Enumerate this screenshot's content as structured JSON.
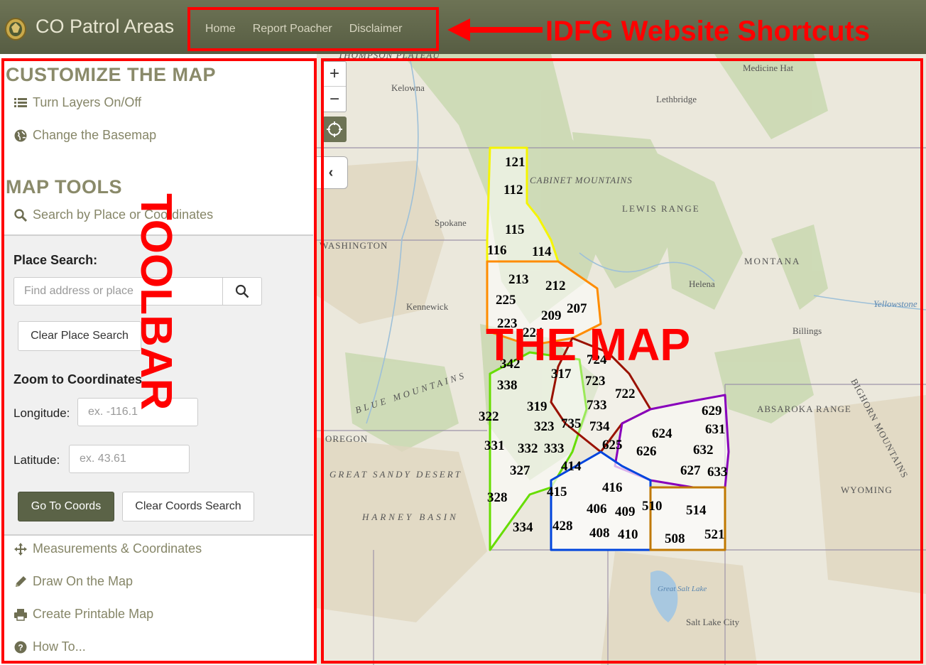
{
  "header": {
    "title": "CO Patrol Areas",
    "nav": [
      "Home",
      "Report Poacher",
      "Disclaimer"
    ]
  },
  "sidebar": {
    "customize_heading": "CUSTOMIZE THE MAP",
    "layers_label": "Turn Layers On/Off",
    "basemap_label": "Change the Basemap",
    "tools_heading": "MAP TOOLS",
    "search_label": "Search by Place or Coordinates",
    "place_search_label": "Place Search:",
    "address_placeholder": "Find address or place",
    "clear_place_label": "Clear Place Search",
    "zoom_coords_label": "Zoom to Coordinates",
    "longitude_label": "Longitude:",
    "longitude_placeholder": "ex. -116.1",
    "latitude_label": "Latitude:",
    "latitude_placeholder": "ex. 43.61",
    "go_coords_label": "Go To Coords",
    "clear_coords_label": "Clear Coords Search",
    "measure_label": "Measurements & Coordinates",
    "draw_label": "Draw On the Map",
    "print_label": "Create Printable Map",
    "howto_label": "How To..."
  },
  "map": {
    "place_labels": [
      "THOMPSON PLATEAU",
      "Kelowna",
      "Medicine Hat",
      "Lethbridge",
      "CABINET MOUNTAINS",
      "Spokane",
      "LEWIS RANGE",
      "WASHINGTON",
      "MONTANA",
      "Helena",
      "Kennewick",
      "Yellowstone",
      "Billings",
      "ABSAROKA RANGE",
      "BIGHORN MOUNTAINS",
      "OREGON",
      "GREAT SANDY DESERT",
      "WYOMING",
      "HARNEY BASIN",
      "Great Salt Lake",
      "Salt Lake City",
      "BLUE MOUNTAINS"
    ],
    "zoom_in": "+",
    "zoom_out": "−",
    "collapse": "‹",
    "region_colors": {
      "100": "#f5f500",
      "200": "#ff8c00",
      "300": "#66dd00",
      "400": "#0044dd",
      "500": "#c07800",
      "600": "#8800bb",
      "700": "#991100"
    },
    "unit_labels": [
      "121",
      "112",
      "115",
      "116",
      "114",
      "213",
      "212",
      "225",
      "209",
      "207",
      "223",
      "224",
      "342",
      "317",
      "338",
      "724",
      "723",
      "722",
      "319",
      "733",
      "322",
      "323",
      "735",
      "734",
      "331",
      "332",
      "333",
      "625",
      "626",
      "624",
      "629",
      "631",
      "632",
      "627",
      "633",
      "414",
      "327",
      "415",
      "416",
      "328",
      "406",
      "409",
      "510",
      "514",
      "334",
      "428",
      "408",
      "410",
      "508",
      "521"
    ]
  },
  "annotations": {
    "shortcuts_label": "IDFG Website Shortcuts",
    "toolbar_label": "TOOLBAR",
    "map_label": "THE MAP",
    "color": "#ff0000"
  }
}
